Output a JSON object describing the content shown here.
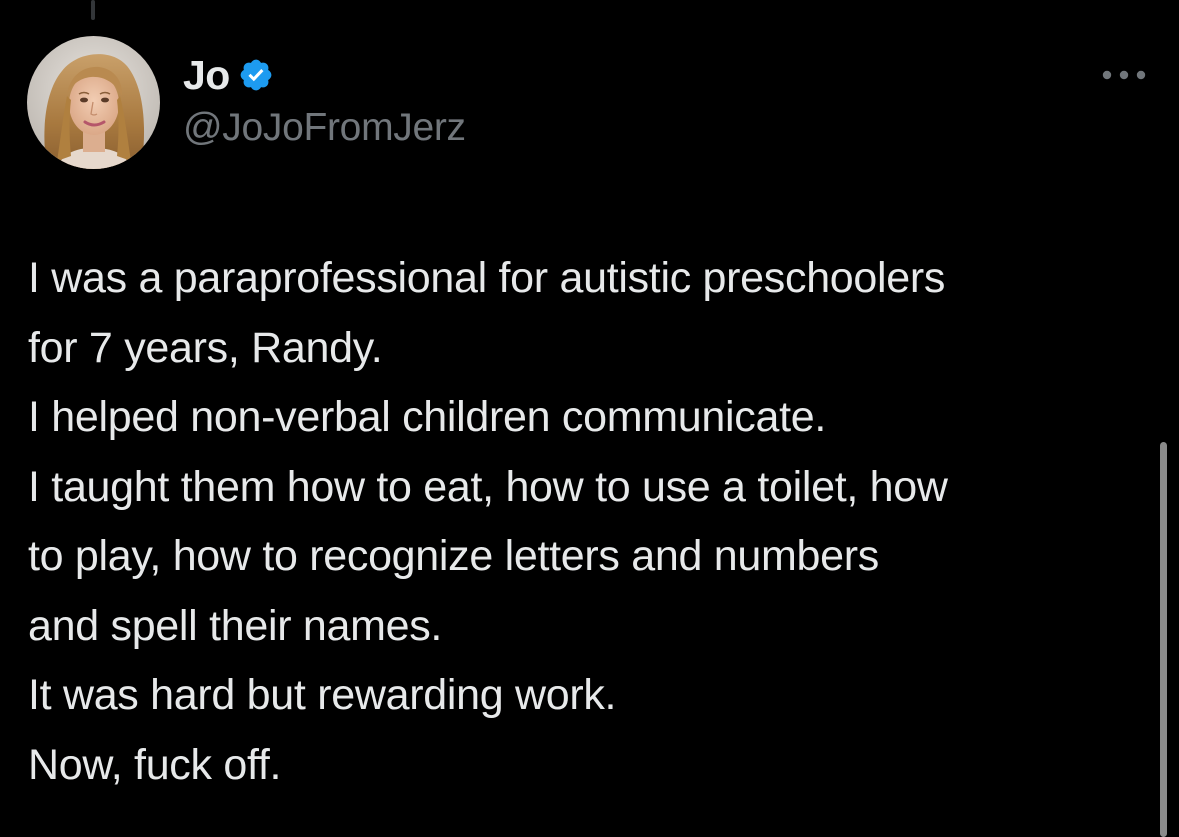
{
  "author": {
    "display_name": "Jo",
    "handle": "@JoJoFromJerz",
    "verified": true,
    "avatar_icon": "avatar-photo",
    "verified_icon": "verified-badge-icon"
  },
  "actions": {
    "more_icon": "more-horizontal-icon"
  },
  "tweet": {
    "lines": [
      "I was a paraprofessional for autistic preschoolers",
      "for 7 years, Randy.",
      "I helped non-verbal children communicate.",
      "I taught them how to eat, how to use a toilet, how",
      "to play, how to recognize letters and numbers",
      "and spell their names.",
      "It was hard but rewarding work.",
      "Now, fuck off."
    ]
  },
  "colors": {
    "background": "#000000",
    "text_primary": "#e7e9ea",
    "text_secondary": "#71767b",
    "verified_blue": "#1d9bf0"
  }
}
